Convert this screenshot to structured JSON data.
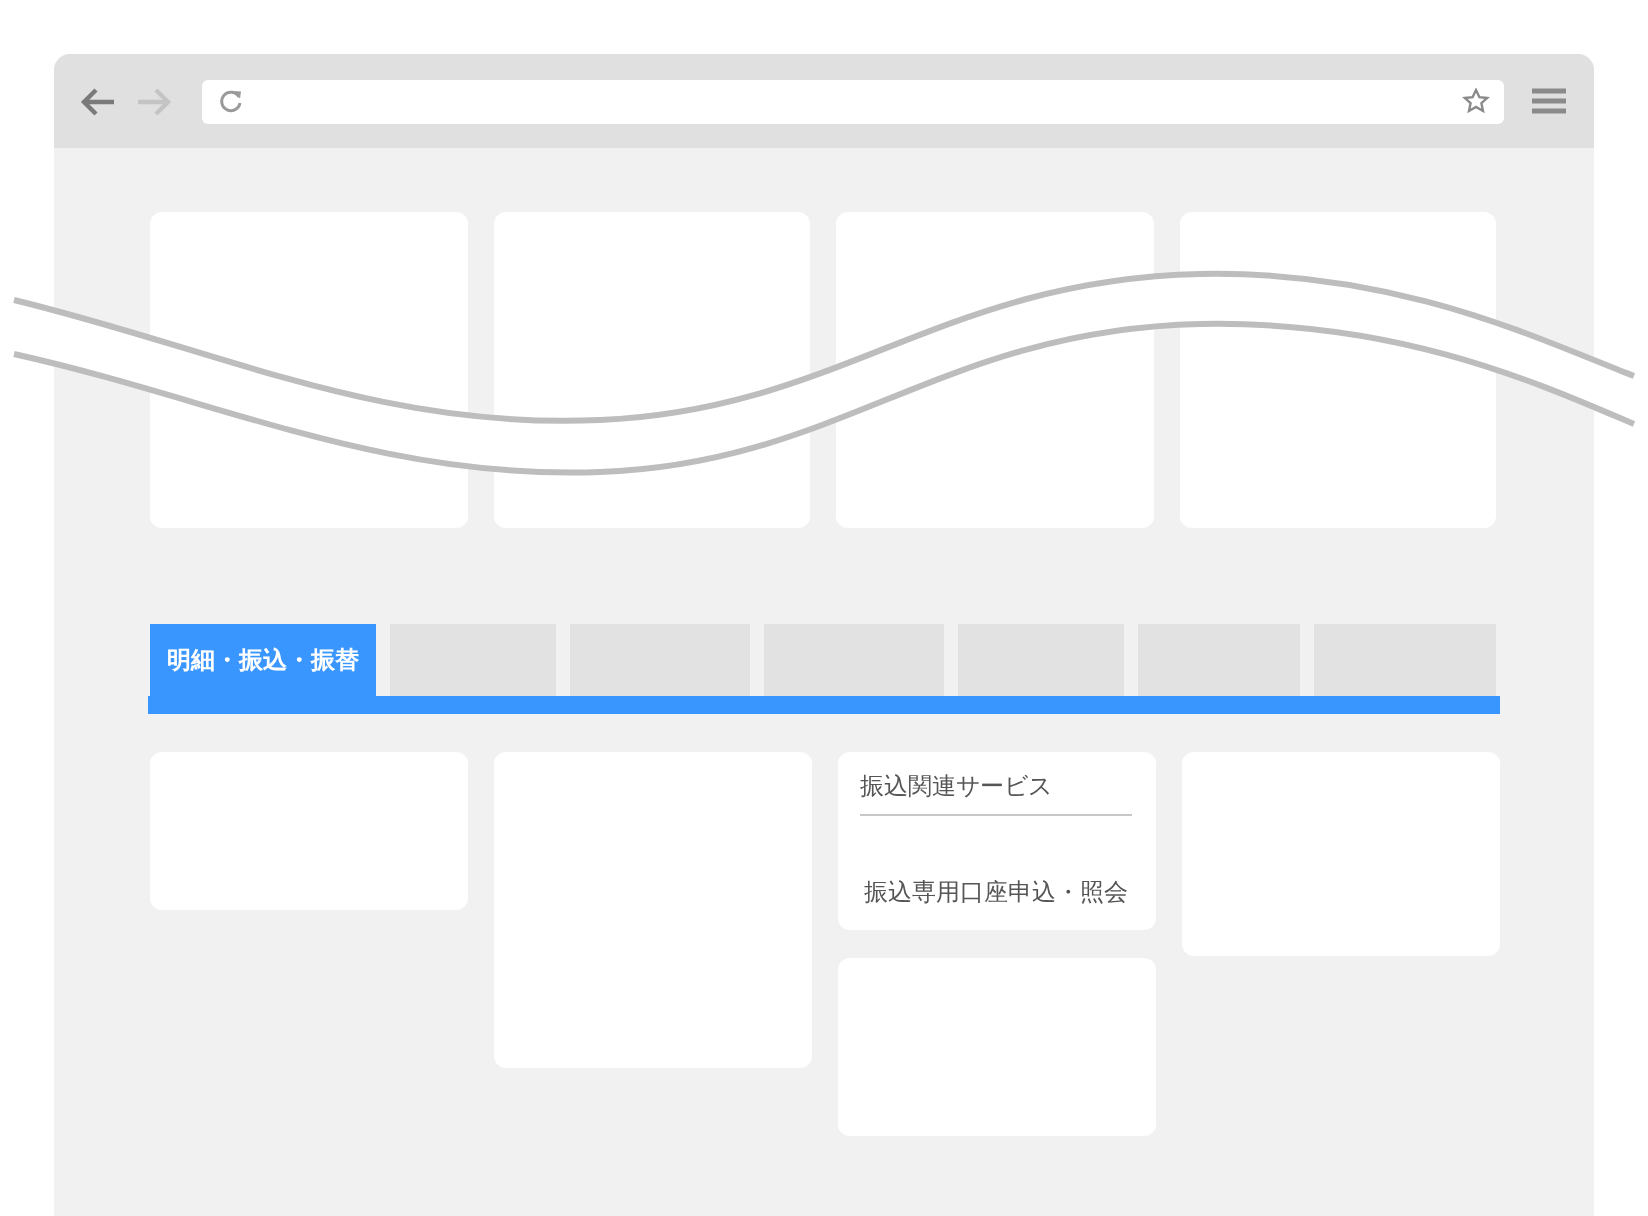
{
  "toolbar": {
    "back": {
      "disabled": false
    },
    "forward": {
      "disabled": true
    }
  },
  "top_cards": [
    {
      "kind": "blank"
    },
    {
      "kind": "blank"
    },
    {
      "kind": "blank"
    },
    {
      "kind": "blank"
    }
  ],
  "tabs": [
    {
      "label": "明細・振込・振替",
      "selected": true
    },
    {
      "selected": false
    },
    {
      "selected": false
    },
    {
      "selected": false
    },
    {
      "selected": false
    },
    {
      "selected": false
    },
    {
      "selected": false
    }
  ],
  "columns": [
    {
      "cards": [
        {
          "kind": "blank"
        }
      ]
    },
    {
      "cards": [
        {
          "kind": "blank"
        }
      ]
    },
    {
      "cards": [
        {
          "kind": "menu",
          "title": "振込関連サービス",
          "links": [
            "振込専用口座申込・照会"
          ]
        },
        {
          "kind": "blank"
        }
      ]
    },
    {
      "cards": [
        {
          "kind": "blank"
        }
      ]
    }
  ]
}
